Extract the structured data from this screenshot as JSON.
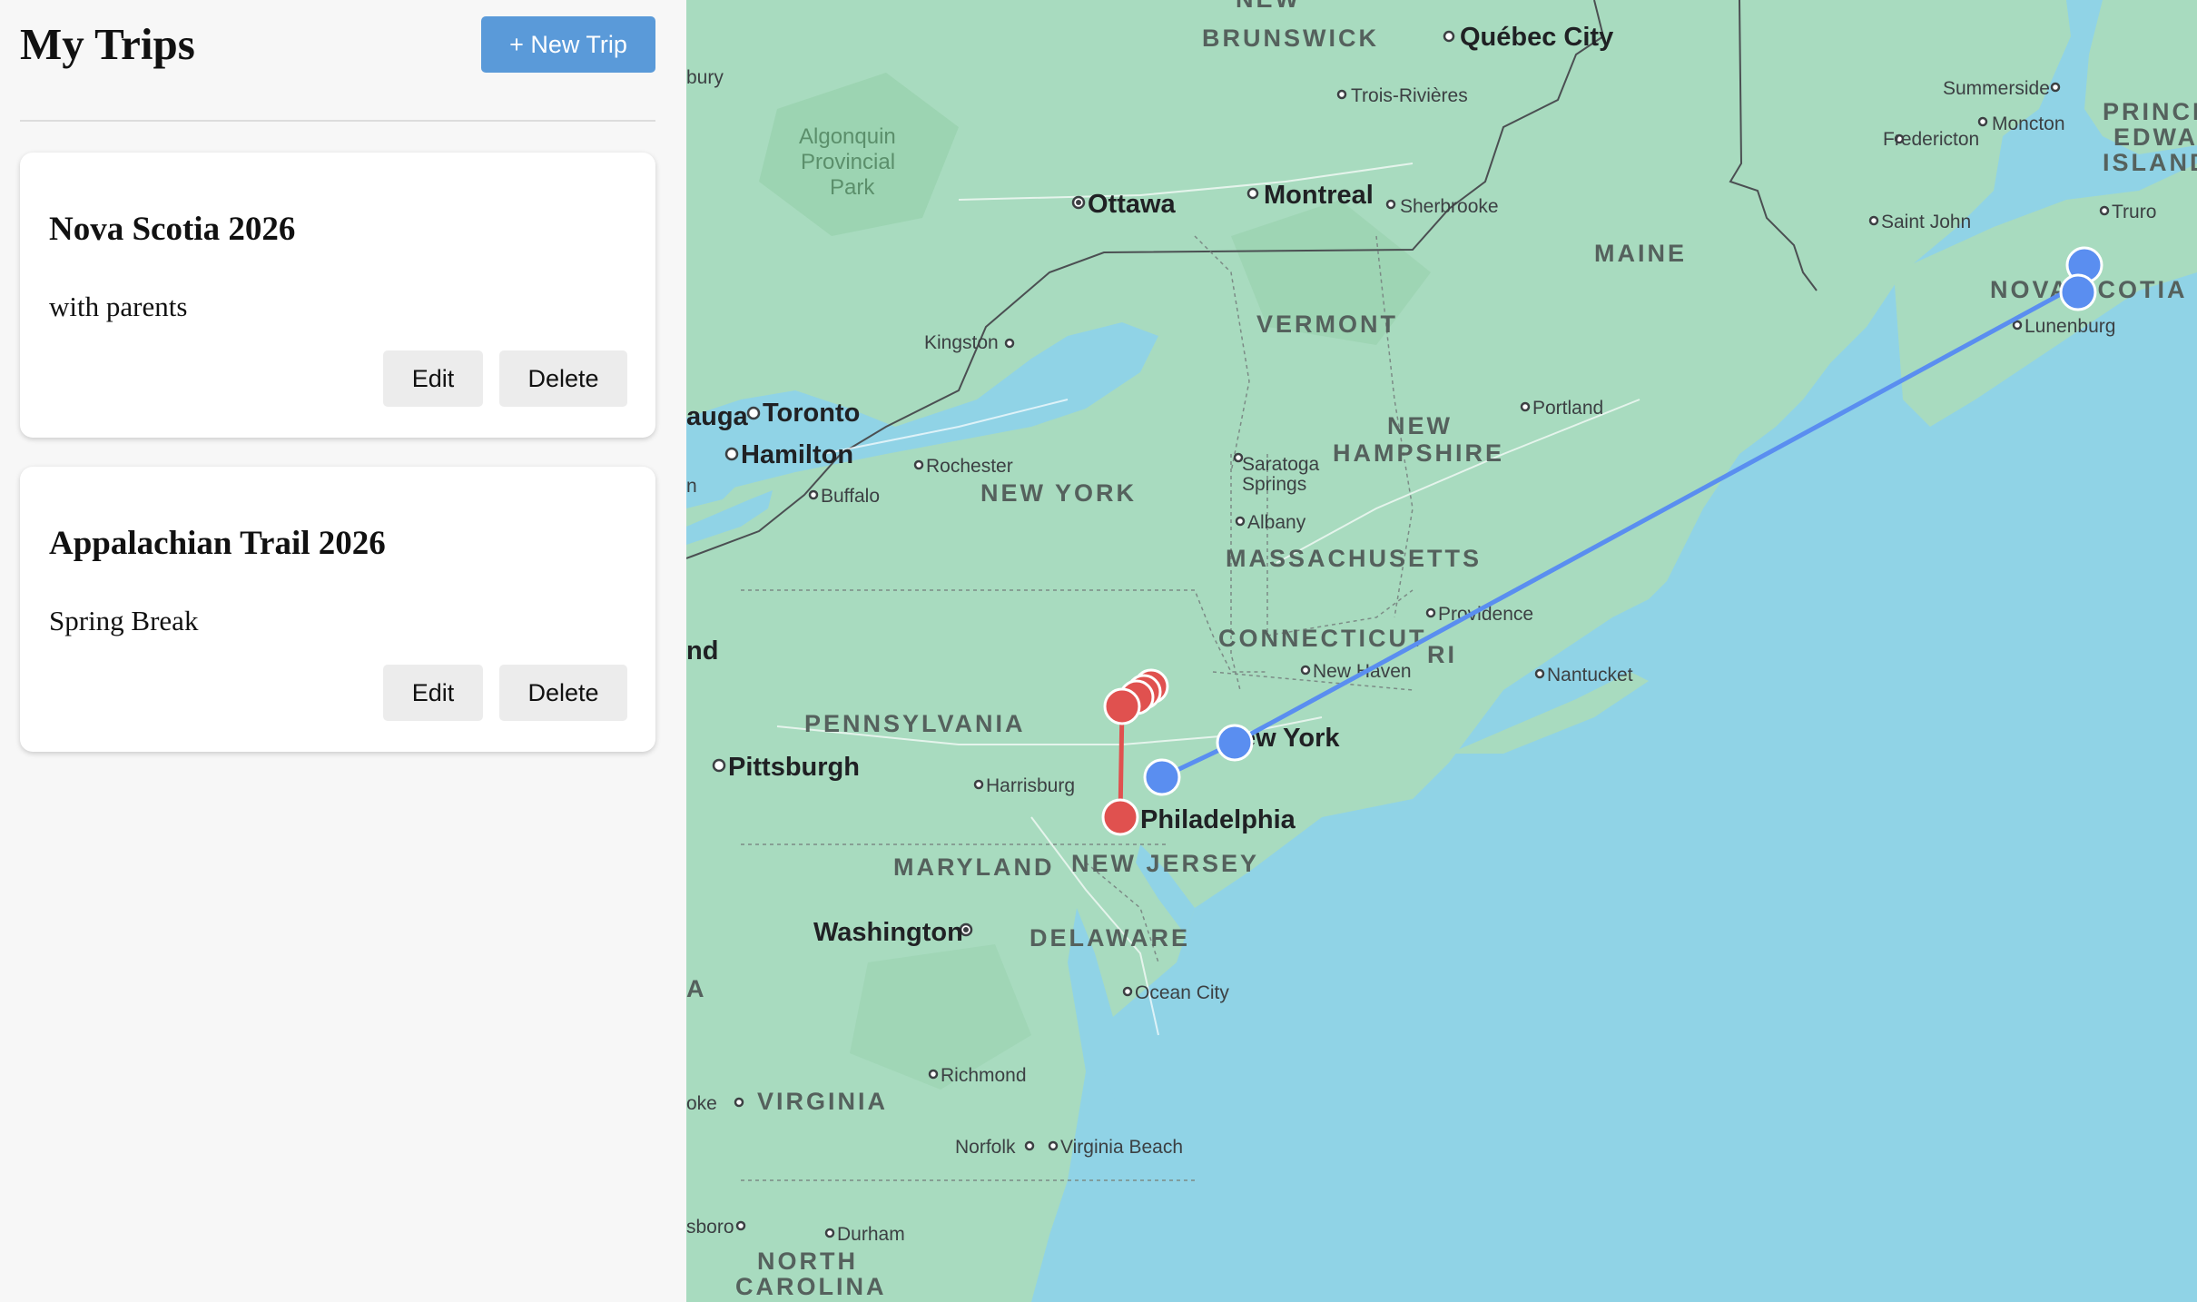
{
  "sidebar": {
    "title": "My Trips",
    "new_trip_label": "+ New Trip",
    "trips": [
      {
        "name": "Nova Scotia 2026",
        "description": "with parents",
        "edit_label": "Edit",
        "delete_label": "Delete"
      },
      {
        "name": "Appalachian Trail 2026",
        "description": "Spring Break",
        "edit_label": "Edit",
        "delete_label": "Delete"
      }
    ]
  },
  "map": {
    "colors": {
      "water": "#90d3e6",
      "land": "#a8dbbf",
      "route_blue": "#5a8ef0",
      "route_red": "#e0514f"
    },
    "regions": {
      "new_brunswick": [
        "NEW",
        "BRUNSWICK"
      ],
      "prince_edward_island": [
        "PRINCE",
        "EDWARD",
        "ISLAND"
      ],
      "maine": "MAINE",
      "vermont": "VERMONT",
      "new_hampshire": [
        "NEW",
        "HAMPSHIRE"
      ],
      "nova_scotia": "NOVA SCOTIA",
      "new_york": "NEW YORK",
      "massachusetts": "MASSACHUSETTS",
      "connecticut": "CONNECTICUT",
      "rhode_island": "RI",
      "pennsylvania": "PENNSYLVANIA",
      "new_jersey": "NEW JERSEY",
      "maryland": "MARYLAND",
      "delaware": "DELAWARE",
      "virginia": "VIRGINIA",
      "north_carolina": [
        "NORTH",
        "CAROLINA"
      ]
    },
    "park": [
      "Algonquin",
      "Provincial",
      "Park"
    ],
    "major_cities": {
      "quebec_city": "Québec City",
      "ottawa": "Ottawa",
      "montreal": "Montreal",
      "toronto": "Toronto",
      "hamilton": "Hamilton",
      "pittsburgh": "Pittsburgh",
      "new_york": "New York",
      "philadelphia": "Philadelphia",
      "washington": "Washington"
    },
    "cities": {
      "trois_rivieres": "Trois-Rivières",
      "sherbrooke": "Sherbrooke",
      "summerside": "Summerside",
      "moncton": "Moncton",
      "fredericton": "Fredericton",
      "saint_john": "Saint John",
      "truro": "Truro",
      "lunenburg": "Lunenburg",
      "kingston": "Kingston",
      "portland": "Portland",
      "rochester": "Rochester",
      "buffalo": "Buffalo",
      "saratoga": [
        "Saratoga",
        "Springs"
      ],
      "albany": "Albany",
      "providence": "Providence",
      "new_haven": "New Haven",
      "nantucket": "Nantucket",
      "harrisburg": "Harrisburg",
      "ocean_city": "Ocean City",
      "richmond": "Richmond",
      "norfolk": "Norfolk",
      "virginia_beach": "Virginia Beach",
      "durham": "Durham"
    },
    "edge_labels": {
      "bury": "bury",
      "auga": "auga",
      "n": "n",
      "nd": "nd",
      "a": "A",
      "oke": "oke",
      "sboro": "sboro"
    }
  }
}
